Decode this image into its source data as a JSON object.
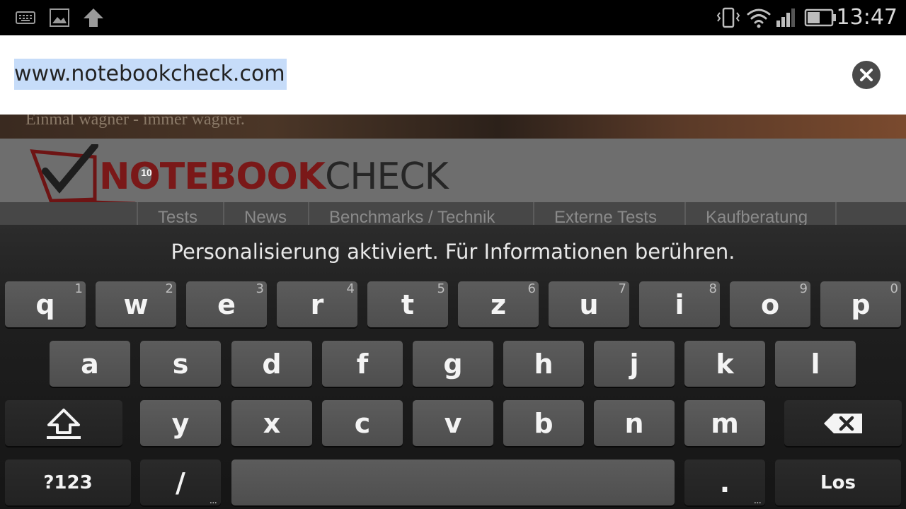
{
  "status_bar": {
    "time": "13:47",
    "left_icons": [
      "keyboard-icon",
      "image-icon",
      "upload-icon"
    ],
    "right_icons": [
      "vibrate-icon",
      "wifi-icon",
      "signal-icon",
      "battery-icon"
    ]
  },
  "url_bar": {
    "url": "www.notebookcheck.com",
    "clear_icon": "close-circle-icon"
  },
  "webpage": {
    "banner_text": "Einmal wagner - immer wagner.",
    "logo_red": "NOTEBOOK",
    "logo_dark": "CHECK",
    "logo_badge": "10",
    "nav": [
      "Tests",
      "News",
      "Benchmarks / Technik",
      "Externe Tests",
      "Kaufberatung"
    ]
  },
  "keyboard": {
    "suggestion": "Personalisierung aktiviert. Für Informationen berühren.",
    "row1": [
      {
        "label": "q",
        "hint": "1"
      },
      {
        "label": "w",
        "hint": "2"
      },
      {
        "label": "e",
        "hint": "3"
      },
      {
        "label": "r",
        "hint": "4"
      },
      {
        "label": "t",
        "hint": "5"
      },
      {
        "label": "z",
        "hint": "6"
      },
      {
        "label": "u",
        "hint": "7"
      },
      {
        "label": "i",
        "hint": "8"
      },
      {
        "label": "o",
        "hint": "9"
      },
      {
        "label": "p",
        "hint": "0"
      }
    ],
    "row2": [
      "a",
      "s",
      "d",
      "f",
      "g",
      "h",
      "j",
      "k",
      "l"
    ],
    "row3": [
      "y",
      "x",
      "c",
      "v",
      "b",
      "n",
      "m"
    ],
    "symbols_label": "?123",
    "slash_label": "/",
    "period_label": ".",
    "more_dots": "...",
    "enter_label": "Los",
    "shift_icon": "shift-arrow-icon",
    "backspace_icon": "backspace-icon",
    "accent_colors": {
      "brand_red": "#7a1818",
      "key_gray": "#575757"
    }
  }
}
